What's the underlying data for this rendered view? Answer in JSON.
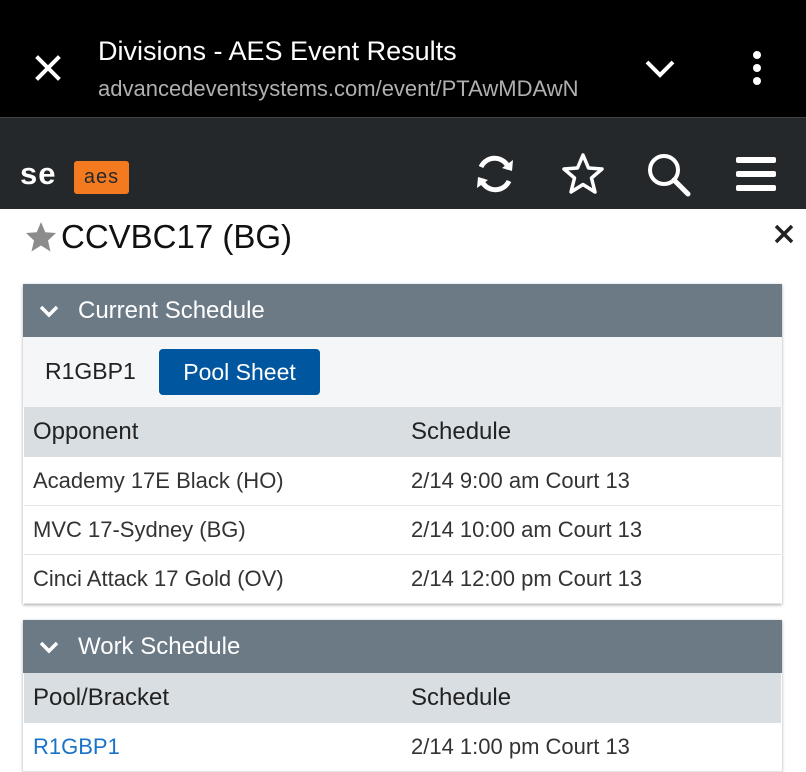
{
  "browser": {
    "title": "Divisions - AES Event Results",
    "url": "advancedeventsystems.com/event/PTAwMDAwN"
  },
  "app": {
    "logo_left": "se",
    "logo_right": "aes",
    "brand_color": "#f47a20"
  },
  "team": {
    "name": "CCVBC17 (BG)"
  },
  "current_schedule": {
    "header": "Current Schedule",
    "pool": "R1GBP1",
    "pool_sheet_label": "Pool Sheet",
    "columns": [
      "Opponent",
      "Schedule"
    ],
    "rows": [
      {
        "opponent": "Academy 17E Black (HO)",
        "schedule": "2/14 9:00 am Court 13"
      },
      {
        "opponent": "MVC 17-Sydney (BG)",
        "schedule": "2/14 10:00 am Court 13"
      },
      {
        "opponent": "Cinci Attack 17 Gold (OV)",
        "schedule": "2/14 12:00 pm Court 13"
      }
    ]
  },
  "work_schedule": {
    "header": "Work Schedule",
    "columns": [
      "Pool/Bracket",
      "Schedule"
    ],
    "rows": [
      {
        "pool": "R1GBP1",
        "schedule": "2/14 1:00 pm Court 13"
      }
    ]
  },
  "icons": {
    "tab_close": "close-icon",
    "tab_chevron": "chevron-down-icon",
    "tab_more": "more-vertical-icon",
    "refresh": "refresh-icon",
    "favorite": "star-outline-icon",
    "search": "search-icon",
    "menu": "hamburger-menu-icon",
    "team_star": "star-filled-icon",
    "panel_close": "close-icon"
  }
}
